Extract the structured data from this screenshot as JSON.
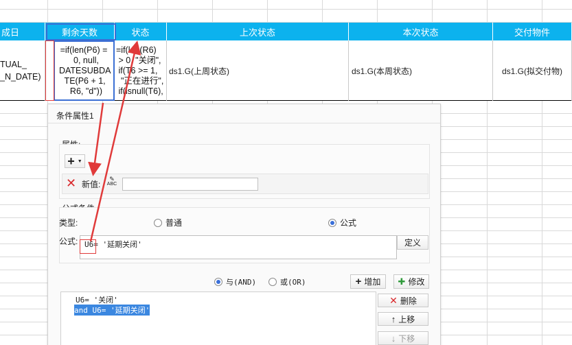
{
  "sheet": {
    "headers": [
      "成日",
      "剩余天数",
      "状态",
      "上次状态",
      "本次状态",
      "交付物件"
    ],
    "cells": {
      "col_a": "TUAL_\n_N_DATE)",
      "remaining_days_formula": "=if(len(P6) =\n  0, null,\n DATESUBDA\n TE(P6 + 1,\n  R6, \"d\"))",
      "status_formula": "=if(len(R6)\n > 0, \"关闭\",\n if(T6 >= 1,\n  \"正在进行\",\n if(isnull(T6),",
      "last_status": "ds1.G(上周状态)",
      "current_status": "ds1.G(本周状态)",
      "deliverable": "ds1.G(拟交付物)"
    }
  },
  "dialog": {
    "title": "条件属性1",
    "attributes": {
      "section_label": "属性:",
      "add_icon": "plus-icon",
      "new_value_label": "新值:",
      "new_value_icon": "abc-format-icon",
      "new_value": ""
    },
    "formula_condition": {
      "section_label": "公式条件",
      "type_label": "类型:",
      "type_options": [
        "普通",
        "公式"
      ],
      "type_selected": "公式",
      "formula_label": "公式:",
      "formula_value": "U6= '延期关闭'",
      "define_button": "定义"
    },
    "logic": {
      "options": [
        "与(AND)",
        "或(OR)"
      ],
      "selected": "与(AND)",
      "add_button": "增加",
      "modify_button": "修改"
    },
    "conditions": [
      {
        "text": "U6= '关闭'",
        "selected": false
      },
      {
        "text": "and U6= '延期关闭'",
        "selected": true
      }
    ],
    "list_buttons": {
      "delete": "删除",
      "up": "上移",
      "down": "下移"
    }
  },
  "colors": {
    "header_blue": "#0cb2ee",
    "annotation_red": "#e03a3a",
    "selection_blue": "#3b6fd4"
  }
}
